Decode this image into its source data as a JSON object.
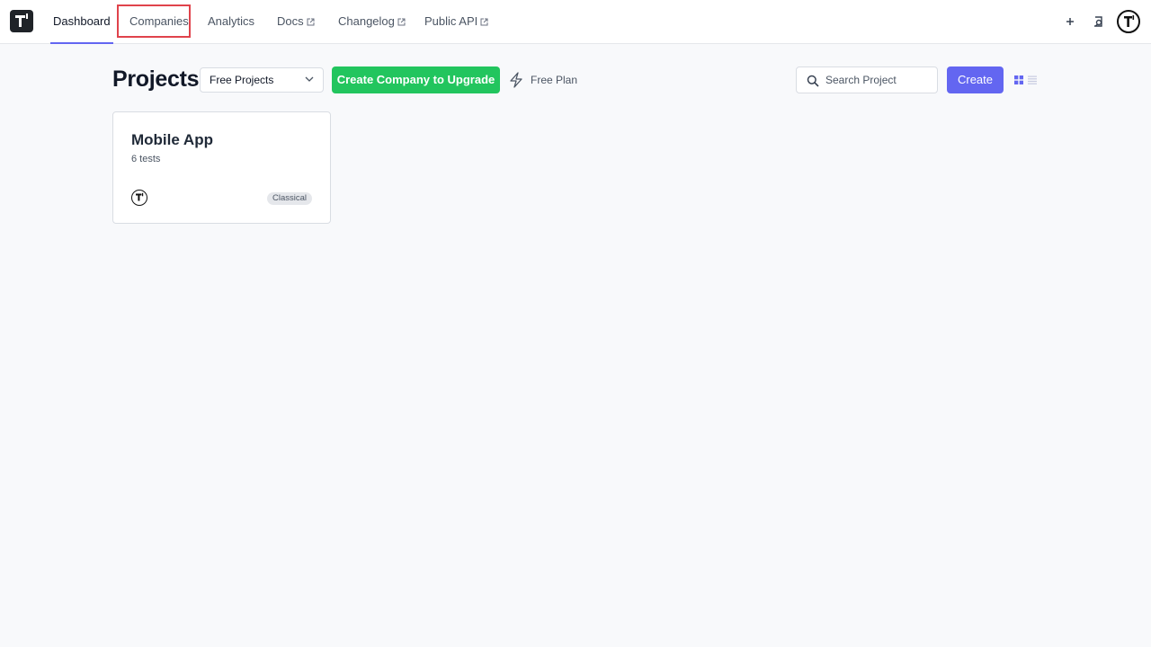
{
  "nav": {
    "items": [
      {
        "label": "Dashboard",
        "external": false,
        "active": true
      },
      {
        "label": "Companies",
        "external": false,
        "active": false
      },
      {
        "label": "Analytics",
        "external": false,
        "active": false
      },
      {
        "label": "Docs",
        "external": true,
        "active": false
      },
      {
        "label": "Changelog",
        "external": true,
        "active": false
      },
      {
        "label": "Public API",
        "external": true,
        "active": false
      }
    ],
    "right_icons": [
      "plus-icon",
      "search-doc-icon",
      "user-avatar-icon"
    ],
    "accent_color": "#6366f1",
    "highlight_color": "#e0434b"
  },
  "toolbar": {
    "title": "Projects",
    "project_filter": "Free Projects",
    "upgrade_label": "Create Company to Upgrade",
    "plan_label": "Free Plan",
    "search_placeholder": "Search Project",
    "create_label": "Create",
    "upgrade_color": "#22c55e",
    "create_color": "#6366f1"
  },
  "projects": [
    {
      "name": "Mobile App",
      "tests": "6 tests",
      "type": "Classical"
    }
  ]
}
